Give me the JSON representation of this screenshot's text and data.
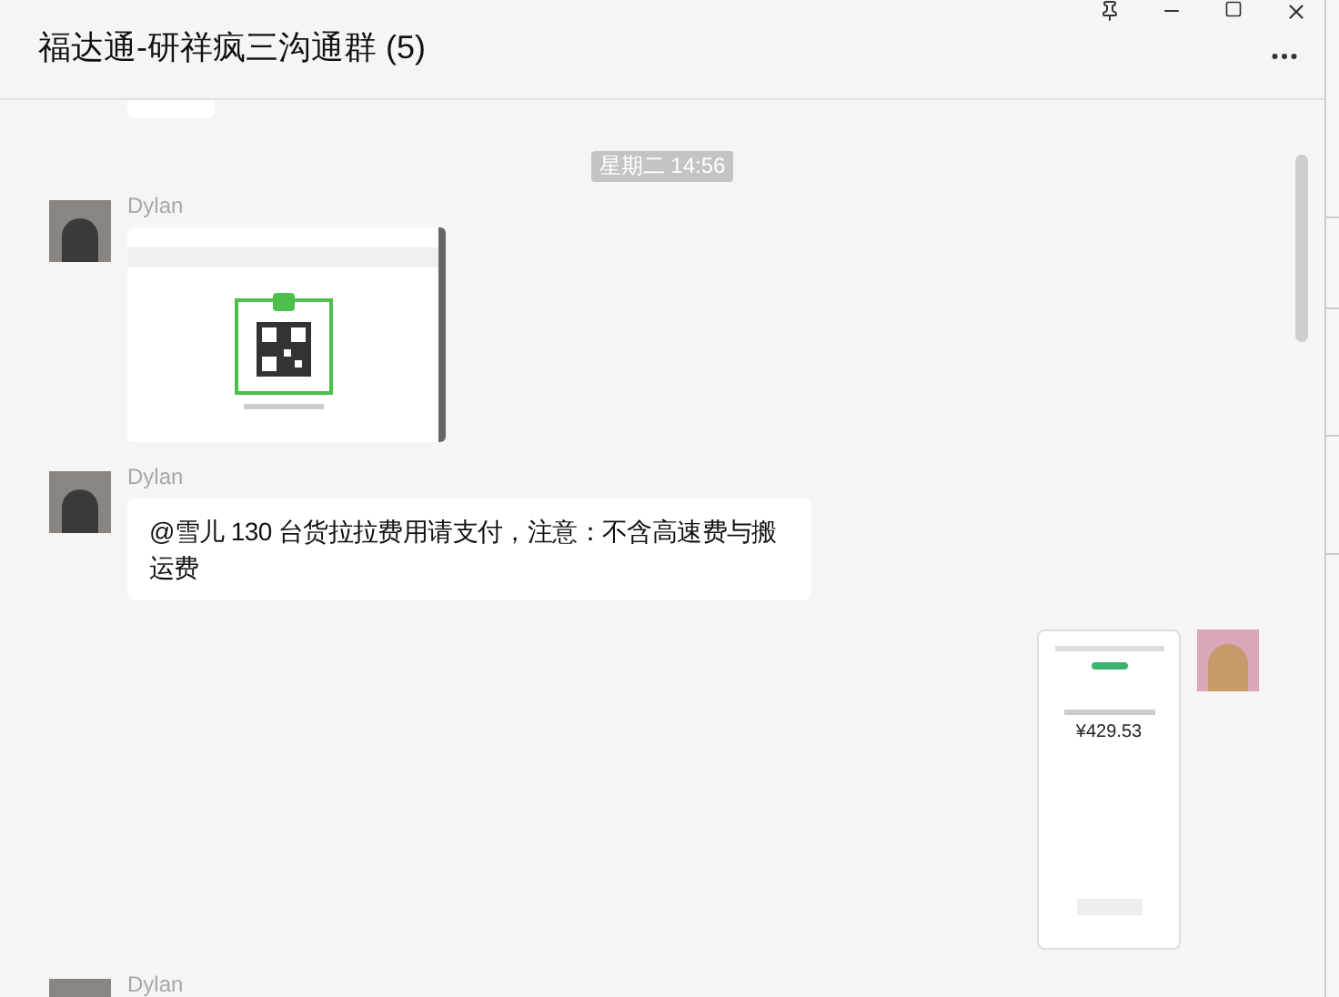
{
  "window": {
    "title": "福达通-研祥疯三沟通群 (5)"
  },
  "timestamp": "星期二 14:56",
  "messages": [
    {
      "sender": "Dylan",
      "outgoing": false,
      "kind": "qr-image"
    },
    {
      "sender": "Dylan",
      "outgoing": false,
      "kind": "text",
      "text": "@雪儿 130 台货拉拉费用请支付，注意：不含高速费与搬运费"
    },
    {
      "outgoing": true,
      "kind": "receipt",
      "amount": "¥429.53"
    },
    {
      "sender": "Dylan",
      "outgoing": false,
      "kind": "partial"
    }
  ]
}
